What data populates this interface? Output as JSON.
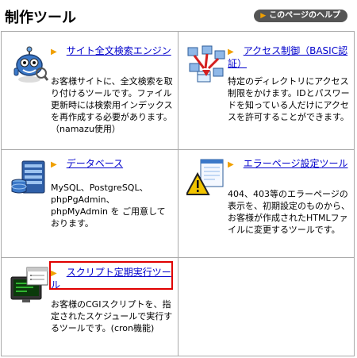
{
  "header": {
    "title": "制作ツール",
    "help_label": "このページのヘルプ"
  },
  "tools": [
    {
      "title": "サイト全文検索エンジン",
      "description": "お客様サイトに、全文検索を取り付けるツールです。ファイル更新時には検索用インデックスを再作成する必要があります。（namazu使用）",
      "icon": "search-engine-robot-icon"
    },
    {
      "title": "アクセス制御（BASIC認証）",
      "description": "特定のディレクトリにアクセス制限をかけます。IDとパスワードを知っている人だけにアクセスを許可することができます。",
      "icon": "access-control-icon"
    },
    {
      "title": "データベース",
      "description": "MySQL、PostgreSQL、phpPgAdmin、 phpMyAdmin を ご用意しております。",
      "icon": "database-server-icon"
    },
    {
      "title": "エラーページ設定ツール",
      "description": "404、403等のエラーページの表示を、初期設定のものから、お客様が作成されたHTMLファイルに変更するツールです。",
      "icon": "warning-page-icon"
    },
    {
      "title": "スクリプト定期実行ツール",
      "description": "お客様のCGIスクリプトを、指定されたスケジュールで実行するツールです。(cron機能)",
      "icon": "scheduler-monitor-icon"
    }
  ],
  "colors": {
    "link": "#0000cc",
    "arrow": "#f0a000",
    "highlight": "#e00000",
    "help_bg": "#555555"
  }
}
